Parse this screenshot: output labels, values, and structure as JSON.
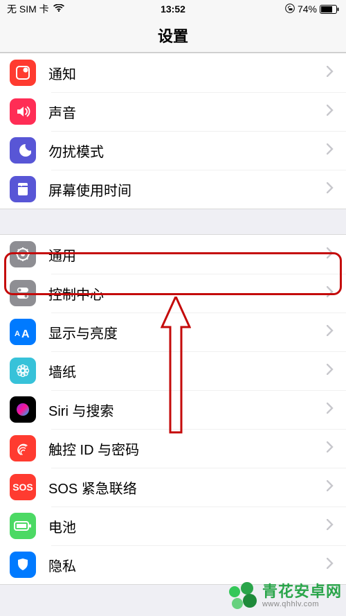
{
  "status": {
    "carrier": "无 SIM 卡",
    "time": "13:52",
    "battery_pct": "74%"
  },
  "nav": {
    "title": "设置"
  },
  "group1": {
    "items": [
      {
        "label": "通知",
        "icon_bg": "#ff3b30",
        "icon": "notifications"
      },
      {
        "label": "声音",
        "icon_bg": "#ff2d55",
        "icon": "sounds"
      },
      {
        "label": "勿扰模式",
        "icon_bg": "#5856d6",
        "icon": "dnd"
      },
      {
        "label": "屏幕使用时间",
        "icon_bg": "#5856d6",
        "icon": "screentime"
      }
    ]
  },
  "group2": {
    "items": [
      {
        "label": "通用",
        "icon_bg": "#8e8e93",
        "icon": "general"
      },
      {
        "label": "控制中心",
        "icon_bg": "#8e8e93",
        "icon": "controlcenter"
      },
      {
        "label": "显示与亮度",
        "icon_bg": "#007aff",
        "icon": "display"
      },
      {
        "label": "墙纸",
        "icon_bg": "#37c2d9",
        "icon": "wallpaper"
      },
      {
        "label": "Siri 与搜索",
        "icon_bg": "#000000",
        "icon": "siri"
      },
      {
        "label": "触控 ID 与密码",
        "icon_bg": "#ff3b30",
        "icon": "touchid"
      },
      {
        "label": "SOS 紧急联络",
        "icon_bg": "#ff3b30",
        "icon": "sos",
        "text": "SOS"
      },
      {
        "label": "电池",
        "icon_bg": "#4cd964",
        "icon": "battery"
      },
      {
        "label": "隐私",
        "icon_bg": "#007aff",
        "icon": "privacy"
      }
    ]
  },
  "watermark": {
    "main": "青花安卓网",
    "sub": "www.qhhlv.com"
  },
  "highlight_index": 0
}
